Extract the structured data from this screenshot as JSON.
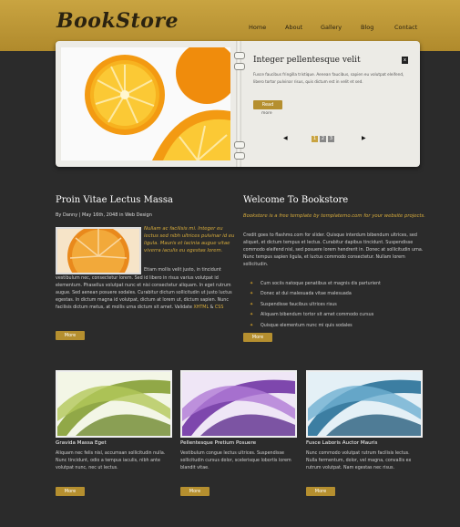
{
  "header": {
    "logo": "BookStore",
    "nav": [
      "Home",
      "About",
      "Gallery",
      "Blog",
      "Contact"
    ]
  },
  "slider": {
    "title": "Integer pellentesque velit",
    "text": "Fusce faucibus fringilla tristique. Aenean faucibus, sapien eu volutpat eleifend, libero tortor pulvinar risus, quis dictum est in velit et sed.",
    "read_label": "Read",
    "more_label": "more",
    "pages": [
      "1",
      "2",
      "3"
    ],
    "close": "x"
  },
  "left": {
    "title": "Proin Vitae Lectus Massa",
    "meta": "By Danny | May 16th, 2048 in Web Design",
    "intro": "Nullam ac facilisis mi. Integer eu lectus sed nibh ultrices pulvinar id eu ligula. Mauris et lacinia augue vitae viverra iaculis eu egestas lorem.",
    "body_top": "Etiam mollis velit justo, in tincidunt",
    "body": "vestibulum nec, consectetur lorem. Sed id libero in risus varius volutpat id elementum. Phasellus volutpat nunc et nisi consectetur aliquam. In eget rutrum augue. Sed aenean posuere sodales. Curabitur dictum sollicitudin ut justo luctus egestas. In dictum magna id volutpat, dictum at lorem ut, dictum sapien. Nunc facilisis dictum metus, at mollis urna dictum sit amet. Validate ",
    "xhtml": "XHTML",
    "amp": " & ",
    "css": "CSS",
    "more_label": "More"
  },
  "right": {
    "title": "Welcome To Bookstore",
    "intro": "Bookstore is a free template by templatemo.com for your website projects.",
    "body": "Credit goes to flashmo.com for slider. Quisque interdum bibendum ultrices, sed aliquet, et dictum tempus et lectus. Curabitur dapibus tincidunt. Suspendisse commodo eleifend nisl, sed posuere lorem hendrerit in. Donec at sollicitudin urna. Nunc tempus sapien ligula, et luctus commodo consectetur. Nullam lorem sollicitudin.",
    "list": [
      "Cum sociis natoque penatibus et magnis dis parturient",
      "Donec at dui malesuada vitae malesuada",
      "Suspendisse faucibus ultrices risus",
      "Aliquam bibendum tortor sit amet commodo cursus",
      "Quisque elementum nunc mi quis sodales"
    ],
    "more_label": "More"
  },
  "tiles": [
    {
      "title": "Gravida Massa Eget",
      "text": "Aliquam nec felis nisl, accumsan sollicitudin nulla. Nunc tincidunt, odio a tempus iaculis, nibh ante volutpat nunc, nec ut lectus.",
      "more_label": "More"
    },
    {
      "title": "Pellentesque Pretium Posuere",
      "text": "Vestibulum congue lectus ultrices. Suspendisse sollicitudin cursus dolor, scelerisque lobortis lorem blandit vitae.",
      "more_label": "More"
    },
    {
      "title": "Fusce Laboris Auctor Mauris",
      "text": "Nunc commodo volutpat rutrum facilisis lectus. Nulla fermentum, dolor, vel magna, convallis ex rutrum volutpat. Nam egestas nec risus.",
      "more_label": "More"
    }
  ],
  "colors": {
    "accent": "#c9a441",
    "bg": "#2b2b2b",
    "link": "#d9ad3c"
  }
}
